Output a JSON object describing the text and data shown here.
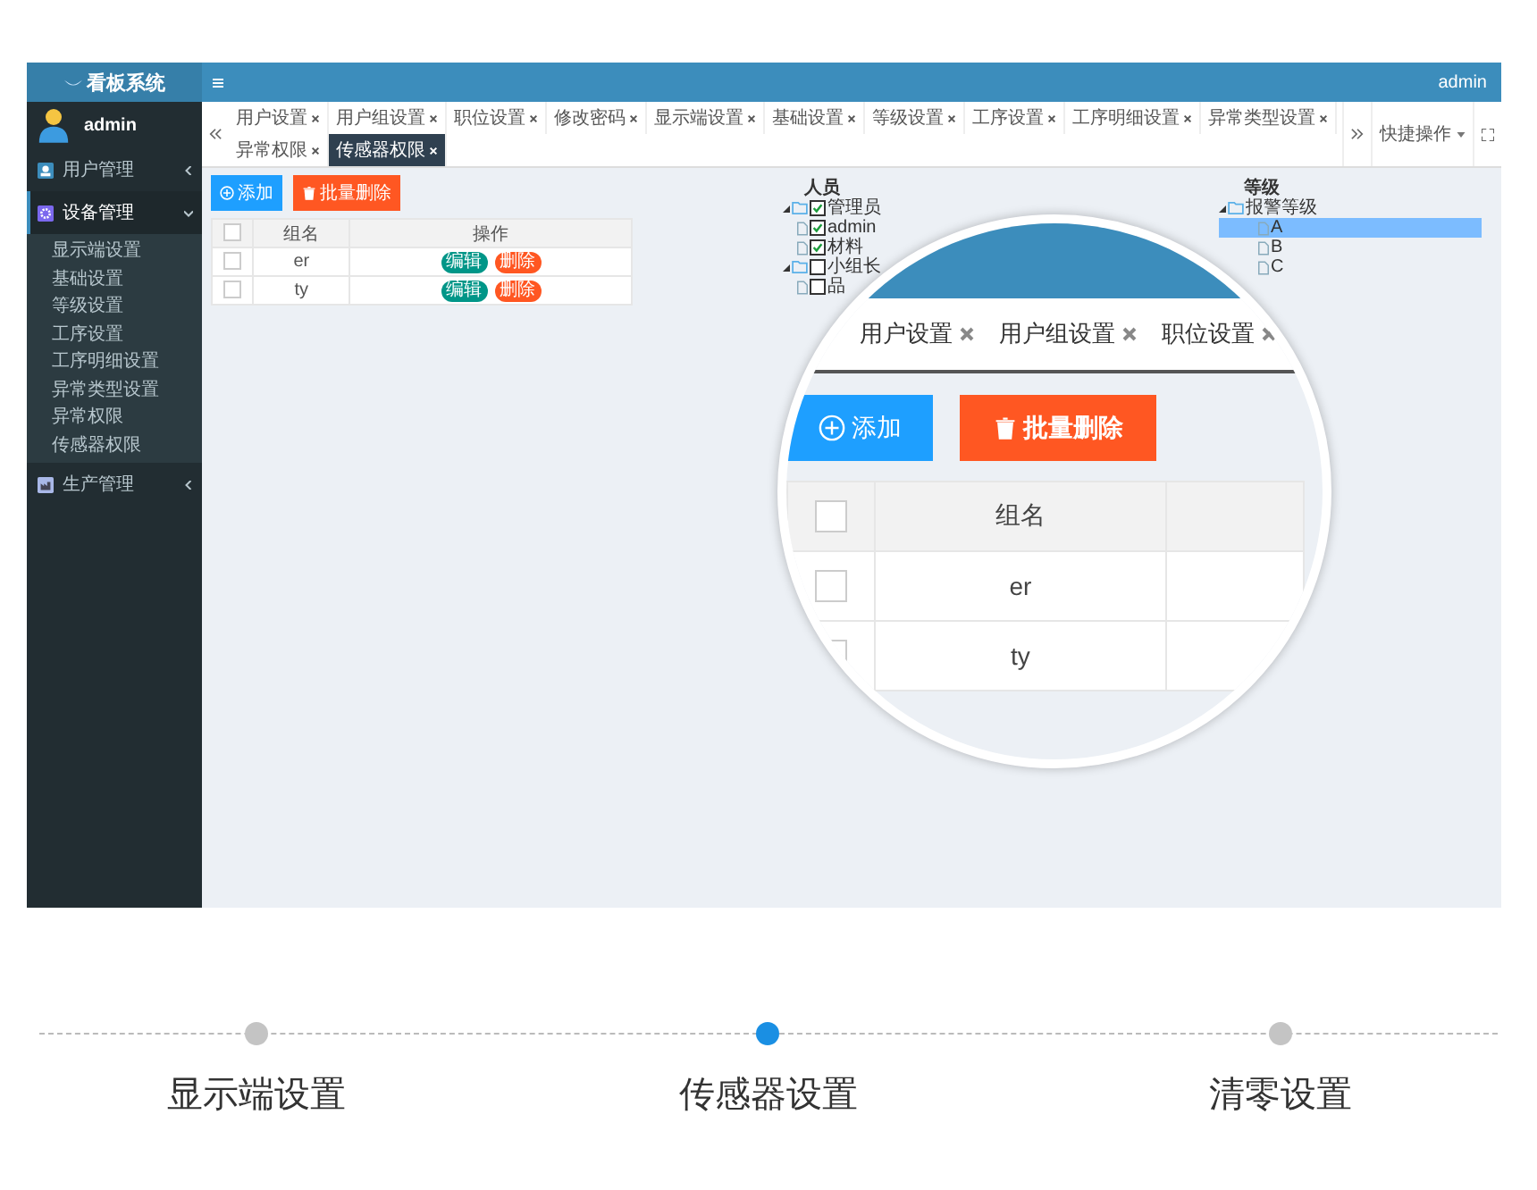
{
  "app": {
    "title": "看板系统",
    "user": "admin"
  },
  "sidebar": {
    "user": "admin",
    "items": [
      {
        "label": "用户管理",
        "expanded": false
      },
      {
        "label": "设备管理",
        "expanded": true,
        "children": [
          "显示端设置",
          "基础设置",
          "等级设置",
          "工序设置",
          "工序明细设置",
          "异常类型设置",
          "异常权限",
          "传感器权限"
        ]
      },
      {
        "label": "生产管理",
        "expanded": false
      }
    ]
  },
  "tabs": [
    {
      "label": "用户设置",
      "selected": false
    },
    {
      "label": "用户组设置",
      "selected": false
    },
    {
      "label": "职位设置",
      "selected": false
    },
    {
      "label": "修改密码",
      "selected": false
    },
    {
      "label": "显示端设置",
      "selected": false
    },
    {
      "label": "基础设置",
      "selected": false
    },
    {
      "label": "等级设置",
      "selected": false
    },
    {
      "label": "工序设置",
      "selected": false
    },
    {
      "label": "工序明细设置",
      "selected": false
    },
    {
      "label": "异常类型设置",
      "selected": false
    },
    {
      "label": "异常权限",
      "selected": false
    },
    {
      "label": "传感器权限",
      "selected": true
    }
  ],
  "quick_ops": "快捷操作",
  "toolbar": {
    "add": "添加",
    "batch_delete": "批量删除"
  },
  "table": {
    "select_all_checked": false,
    "columns": [
      "组名",
      "操作"
    ],
    "rows": [
      {
        "name": "er",
        "checked": false,
        "actions": [
          {
            "kind": "edit",
            "label": "编辑"
          },
          {
            "kind": "delete",
            "label": "删除"
          }
        ]
      },
      {
        "name": "ty",
        "checked": false,
        "actions": [
          {
            "kind": "edit",
            "label": "编辑"
          },
          {
            "kind": "delete",
            "label": "删除"
          }
        ]
      }
    ]
  },
  "personnel_tree": {
    "title": "人员",
    "nodes": [
      {
        "label": "管理员",
        "checked": true,
        "expanded": true,
        "children": [
          {
            "label": "admin",
            "checked": true
          },
          {
            "label": "材料",
            "checked": true
          }
        ]
      },
      {
        "label": "小组长",
        "checked": false,
        "expanded": true,
        "children": [
          {
            "label": "品",
            "checked": false
          }
        ]
      }
    ]
  },
  "level_tree": {
    "title": "等级",
    "nodes": [
      {
        "label": "报警等级",
        "expanded": true,
        "children": [
          {
            "label": "A",
            "selected": true
          },
          {
            "label": "B",
            "selected": false
          },
          {
            "label": "C",
            "selected": false
          }
        ]
      }
    ]
  },
  "magnifier": {
    "tabs": [
      "用户设置",
      "用户组设置",
      "职位设置"
    ],
    "add": "添加",
    "batch_delete": "批量删除",
    "select_all_checked": false,
    "column": "组名",
    "rows": [
      {
        "name": "er",
        "checked": false
      },
      {
        "name": "ty",
        "checked": false
      }
    ]
  },
  "steps": [
    {
      "label": "显示端设置",
      "selected": false
    },
    {
      "label": "传感器设置",
      "selected": true
    },
    {
      "label": "清零设置",
      "selected": false
    }
  ]
}
